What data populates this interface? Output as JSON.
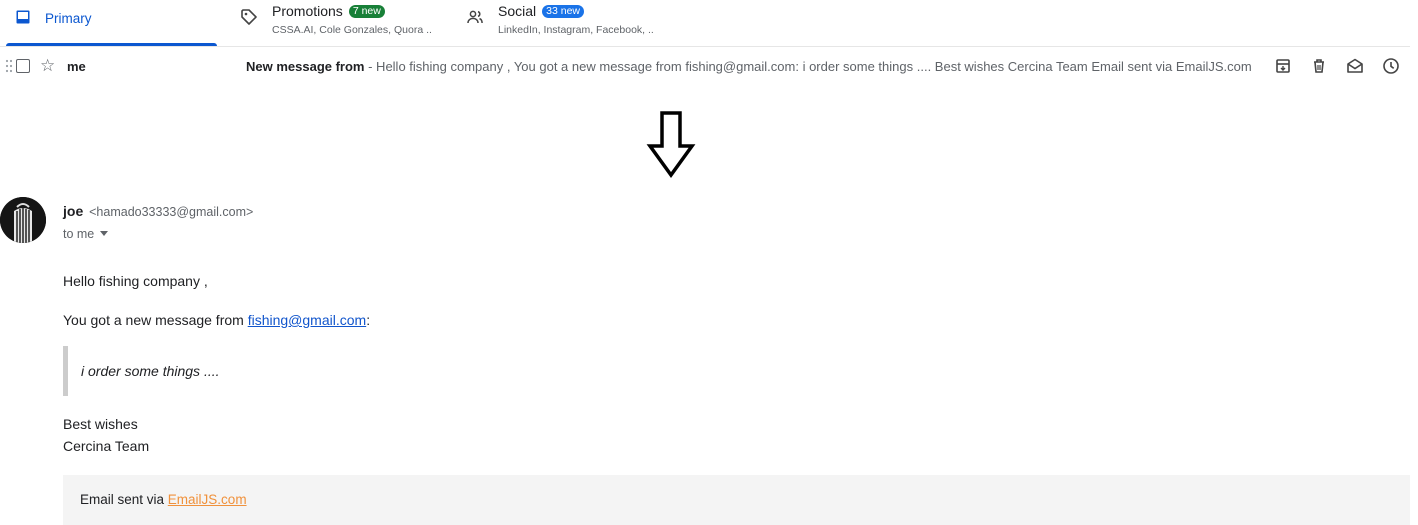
{
  "tabs": {
    "primary": {
      "label": "Primary",
      "icon": "inbox-icon",
      "color": "#0b57d0"
    },
    "promotions": {
      "label": "Promotions",
      "badge": "7 new",
      "badge_color": "#188038",
      "senders": "CSSA.AI, Cole Gonzales, Quora ..",
      "icon": "tag-icon"
    },
    "social": {
      "label": "Social",
      "badge": "33 new",
      "badge_color": "#1a73e8",
      "senders": "LinkedIn, Instagram, Facebook, ..",
      "icon": "people-icon"
    }
  },
  "message_row": {
    "sender": "me",
    "subject": "New message from",
    "snippet": " - Hello fishing company , You got a new message from fishing@gmail.com: i order some things .... Best wishes Cercina Team Email sent via EmailJS.com",
    "actions": [
      "archive-icon",
      "delete-icon",
      "mark-unread-icon",
      "snooze-icon"
    ]
  },
  "email": {
    "from_name": "joe",
    "from_email": "<hamado33333@gmail.com>",
    "to": "to me",
    "greeting": "Hello fishing company ,",
    "line_prefix": "You got a new message from ",
    "link_email": "fishing@gmail.com",
    "line_suffix": ":",
    "quote": "i order some things ....",
    "signoff_1": "Best wishes",
    "signoff_2": "Cercina Team",
    "footer_prefix": "Email sent via ",
    "footer_link": "EmailJS.com",
    "footer_link_color": "#f0913b"
  }
}
